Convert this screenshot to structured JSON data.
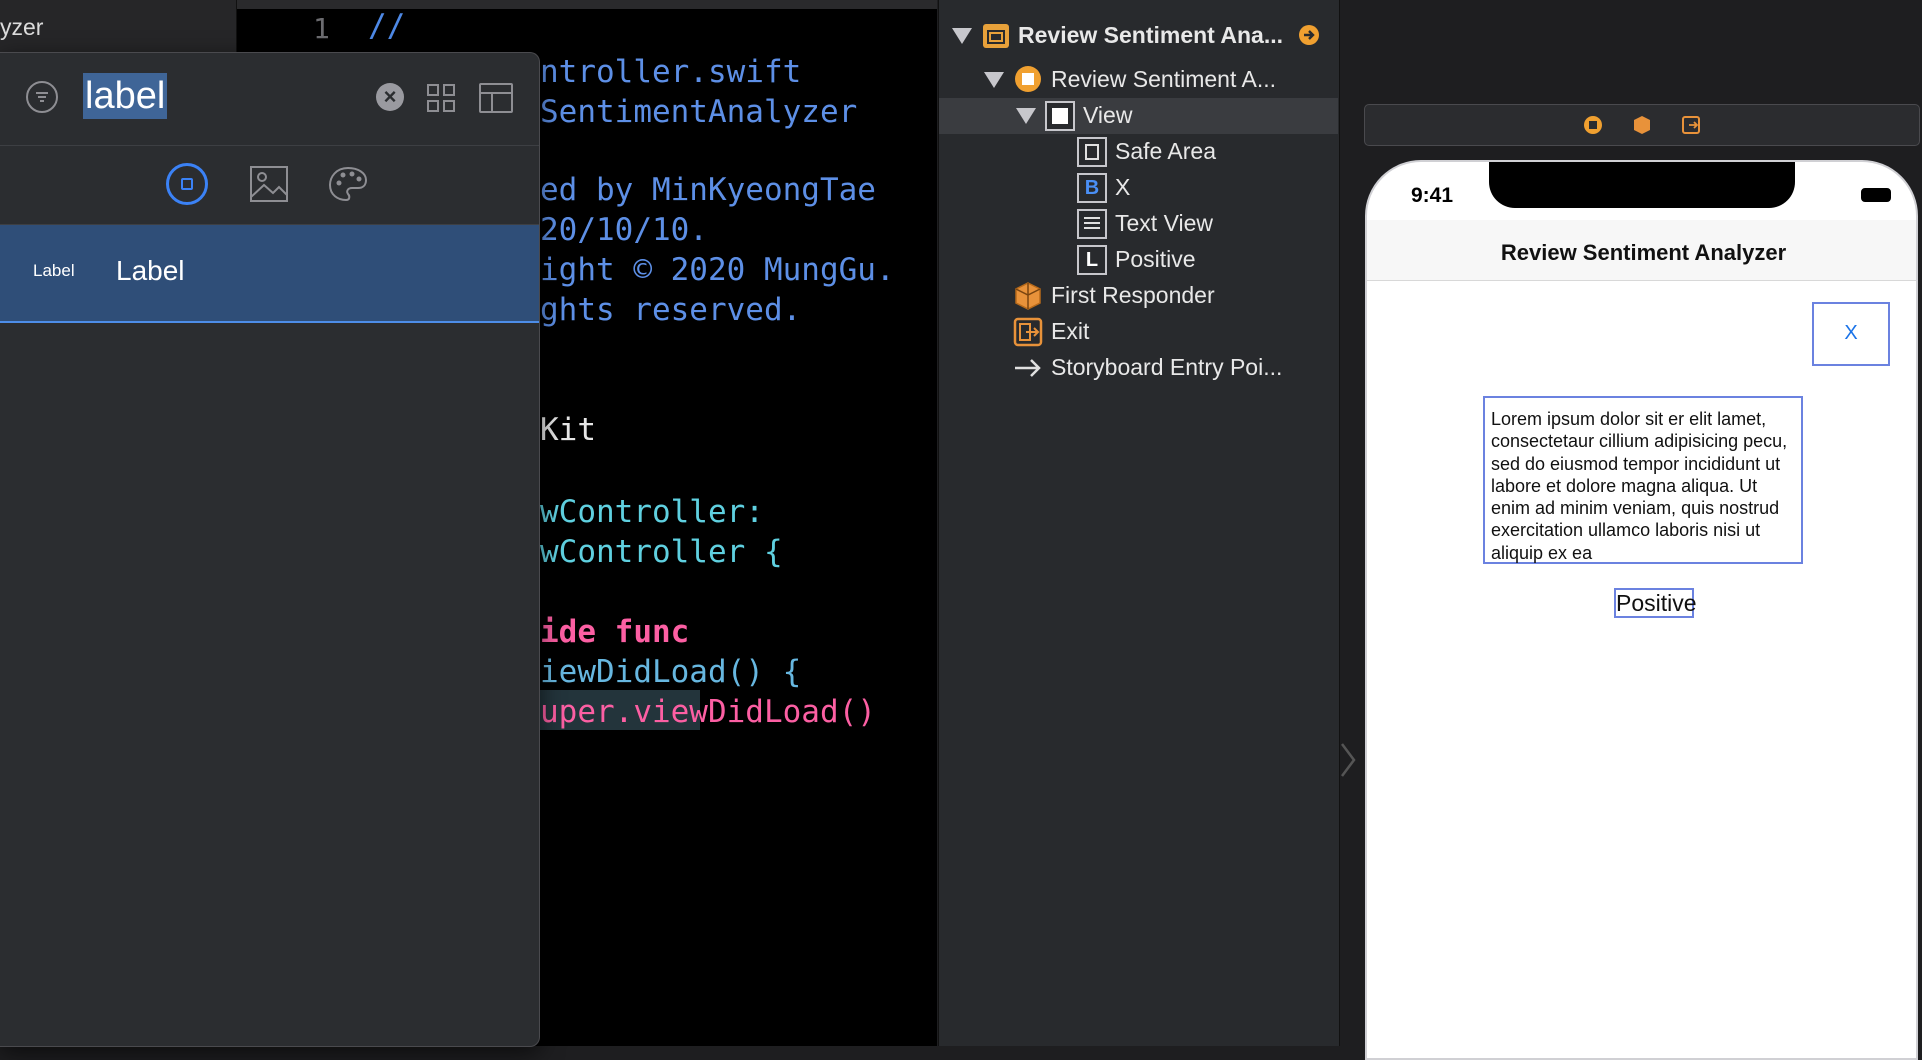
{
  "navigator": {
    "project_fragment": "yzer"
  },
  "editor": {
    "line_number": "1",
    "lines": [
      {
        "text": "//",
        "color": "#4e89e6"
      },
      {
        "text": "ntroller.swift",
        "color": "#5d8fe6"
      },
      {
        "text": "SentimentAnalyzer",
        "color": "#5d8fe6"
      },
      {
        "text": "ed by MinKyeongTae",
        "color": "#5d8fe6"
      },
      {
        "text": "20/10/10.",
        "color": "#5d8fe6"
      },
      {
        "text": "ight © 2020 MungGu.",
        "color": "#5d8fe6"
      },
      {
        "text": "ghts reserved.",
        "color": "#5d8fe6"
      },
      {
        "text": "Kit",
        "color": "#e6e6e6"
      },
      {
        "text": "wController:",
        "color": "#5fd0e0"
      },
      {
        "text": "wController {",
        "color": "#5fd0e0"
      },
      {
        "text": "ide func",
        "color": "#fc5fa3"
      },
      {
        "text": "iewDidLoad() {",
        "color": "#67b7e0"
      },
      {
        "text": "uper.viewDidLoad()",
        "color": "#b281eb"
      }
    ]
  },
  "library": {
    "search_value": "label",
    "result": {
      "small_label": "Label",
      "title": "Label"
    }
  },
  "outline": {
    "scene_title": "Review Sentiment Ana...",
    "controller": "Review Sentiment A...",
    "view": "View",
    "safe_area": "Safe Area",
    "button_x": "X",
    "text_view": "Text View",
    "label_positive": "Positive",
    "first_responder": "First Responder",
    "exit": "Exit",
    "entry": "Storyboard Entry Poi...",
    "icon_button_letter": "B",
    "icon_label_letter": "L"
  },
  "canvas": {
    "status_time": "9:41",
    "nav_title": "Review Sentiment Analyzer",
    "x_button": "X",
    "text_view_body": "Lorem ipsum dolor sit er elit lamet, consectetaur cillium adipisicing pecu, sed do eiusmod tempor incididunt ut labore et dolore magna aliqua. Ut enim ad minim veniam, quis nostrud exercitation ullamco laboris nisi ut aliquip ex ea",
    "positive_label": "Positive"
  },
  "colors": {
    "accent_blue": "#3b82f6",
    "selection": "#2f4e78",
    "storyboard_orange": "#f0a030"
  }
}
